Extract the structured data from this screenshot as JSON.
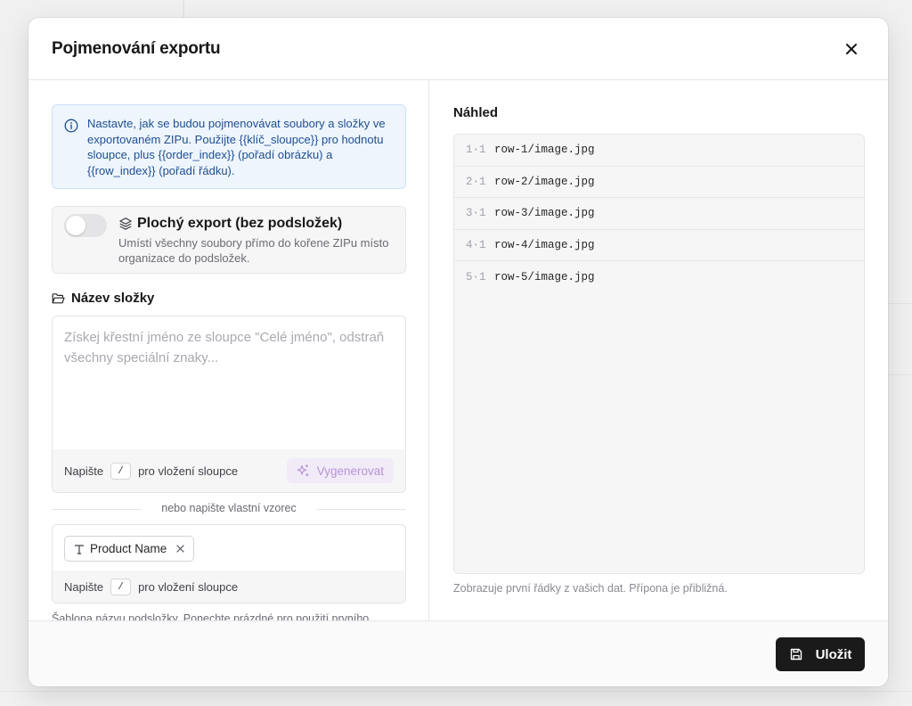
{
  "modal": {
    "title": "Pojmenování exportu"
  },
  "info": {
    "text": "Nastavte, jak se budou pojmenovávat soubory a složky ve exportovaném ZIPu. Použijte {{klíč_sloupce}} pro hodnotu sloupce, plus {{order_index}} (pořadí obrázku) a {{row_index}} (pořadí řádku)."
  },
  "flat_export": {
    "title": "Plochý export (bez podsložek)",
    "description": "Umístí všechny soubory přímo do kořene ZIPu místo organizace do podsložek.",
    "enabled": false
  },
  "folder_name": {
    "label": "Název složky",
    "placeholder": "Získej křestní jméno ze sloupce \"Celé jméno\", odstraň všechny speciální znaky...",
    "hint_before": "Napište",
    "hint_key": "/",
    "hint_after": "pro vložení sloupce",
    "generate_label": "Vygenerovat"
  },
  "divider": {
    "text": "nebo napište vlastní vzorec"
  },
  "pattern": {
    "chip_label": "Product Name",
    "hint_before": "Napište",
    "hint_key": "/",
    "hint_after": "pro vložení sloupce"
  },
  "helper_text": "Šablona názvu podsložky. Ponechte prázdné pro použití prvního",
  "preview": {
    "label": "Náhled",
    "rows": [
      {
        "line": "1·1",
        "path": "row-1/image.jpg"
      },
      {
        "line": "2·1",
        "path": "row-2/image.jpg"
      },
      {
        "line": "3·1",
        "path": "row-3/image.jpg"
      },
      {
        "line": "4·1",
        "path": "row-4/image.jpg"
      },
      {
        "line": "5·1",
        "path": "row-5/image.jpg"
      }
    ],
    "note": "Zobrazuje první řádky z vašich dat. Přípona je přibližná."
  },
  "footer": {
    "save_label": "Uložit"
  },
  "colors": {
    "accent_blue": "#1e4f91",
    "generate_purple": "#b893d6",
    "primary_button": "#1a1a1a"
  }
}
